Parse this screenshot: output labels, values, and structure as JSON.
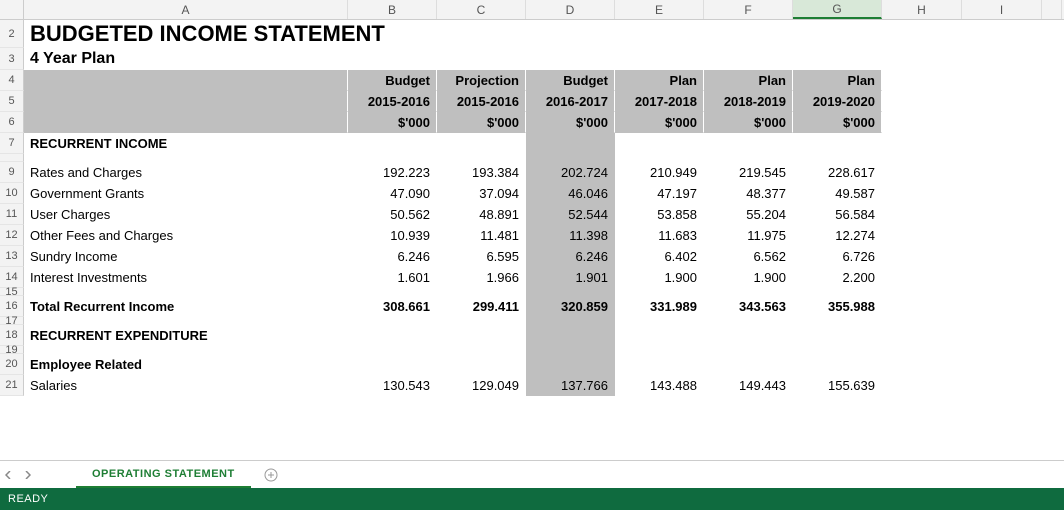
{
  "columns": [
    "A",
    "B",
    "C",
    "D",
    "E",
    "F",
    "G",
    "H",
    "I",
    ""
  ],
  "visible_row_numbers": [
    "2",
    "3",
    "4",
    "5",
    "6",
    "7",
    "",
    "9",
    "10",
    "11",
    "12",
    "13",
    "14",
    "15",
    "16",
    "17",
    "18",
    "19",
    "20",
    "21",
    ""
  ],
  "title": "BUDGETED INCOME STATEMENT",
  "subtitle": "4 Year Plan",
  "header_row1": [
    "Budget",
    "Projection",
    "Budget",
    "Plan",
    "Plan",
    "Plan"
  ],
  "header_row2": [
    "2015-2016",
    "2015-2016",
    "2016-2017",
    "2017-2018",
    "2018-2019",
    "2019-2020"
  ],
  "header_row3": [
    "$'000",
    "$'000",
    "$'000",
    "$'000",
    "$'000",
    "$'000"
  ],
  "section1": "RECURRENT INCOME",
  "rows_income": [
    {
      "label": "Rates and Charges",
      "v": [
        "192.223",
        "193.384",
        "202.724",
        "210.949",
        "219.545",
        "228.617"
      ]
    },
    {
      "label": "Government Grants",
      "v": [
        "47.090",
        "37.094",
        "46.046",
        "47.197",
        "48.377",
        "49.587"
      ]
    },
    {
      "label": "User Charges",
      "v": [
        "50.562",
        "48.891",
        "52.544",
        "53.858",
        "55.204",
        "56.584"
      ]
    },
    {
      "label": "Other Fees and Charges",
      "v": [
        "10.939",
        "11.481",
        "11.398",
        "11.683",
        "11.975",
        "12.274"
      ]
    },
    {
      "label": "Sundry Income",
      "v": [
        "6.246",
        "6.595",
        "6.246",
        "6.402",
        "6.562",
        "6.726"
      ]
    },
    {
      "label": "Interest Investments",
      "v": [
        "1.601",
        "1.966",
        "1.901",
        "1.900",
        "1.900",
        "2.200"
      ]
    }
  ],
  "total_income": {
    "label": "Total Recurrent Income",
    "v": [
      "308.661",
      "299.411",
      "320.859",
      "331.989",
      "343.563",
      "355.988"
    ]
  },
  "section2": "RECURRENT EXPENDITURE",
  "section3": "Employee Related",
  "rows_exp": [
    {
      "label": "Salaries",
      "v": [
        "130.543",
        "129.049",
        "137.766",
        "143.488",
        "149.443",
        "155.639"
      ]
    }
  ],
  "sheet_tab": "OPERATING STATEMENT",
  "status": "READY",
  "selected_column": "G",
  "chart_data": {
    "type": "table",
    "title": "BUDGETED INCOME STATEMENT — 4 Year Plan",
    "column_headers": [
      {
        "label": "Budget",
        "period": "2015-2016",
        "unit": "$'000"
      },
      {
        "label": "Projection",
        "period": "2015-2016",
        "unit": "$'000"
      },
      {
        "label": "Budget",
        "period": "2016-2017",
        "unit": "$'000"
      },
      {
        "label": "Plan",
        "period": "2017-2018",
        "unit": "$'000"
      },
      {
        "label": "Plan",
        "period": "2018-2019",
        "unit": "$'000"
      },
      {
        "label": "Plan",
        "period": "2019-2020",
        "unit": "$'000"
      }
    ],
    "sections": [
      {
        "name": "RECURRENT INCOME",
        "rows": [
          {
            "label": "Rates and Charges",
            "values": [
              192.223,
              193.384,
              202.724,
              210.949,
              219.545,
              228.617
            ]
          },
          {
            "label": "Government Grants",
            "values": [
              47.09,
              37.094,
              46.046,
              47.197,
              48.377,
              49.587
            ]
          },
          {
            "label": "User Charges",
            "values": [
              50.562,
              48.891,
              52.544,
              53.858,
              55.204,
              56.584
            ]
          },
          {
            "label": "Other Fees and Charges",
            "values": [
              10.939,
              11.481,
              11.398,
              11.683,
              11.975,
              12.274
            ]
          },
          {
            "label": "Sundry Income",
            "values": [
              6.246,
              6.595,
              6.246,
              6.402,
              6.562,
              6.726
            ]
          },
          {
            "label": "Interest Investments",
            "values": [
              1.601,
              1.966,
              1.901,
              1.9,
              1.9,
              2.2
            ]
          }
        ],
        "total": {
          "label": "Total Recurrent Income",
          "values": [
            308.661,
            299.411,
            320.859,
            331.989,
            343.563,
            355.988
          ]
        }
      },
      {
        "name": "RECURRENT EXPENDITURE",
        "subsections": [
          {
            "name": "Employee Related",
            "rows": [
              {
                "label": "Salaries",
                "values": [
                  130.543,
                  129.049,
                  137.766,
                  143.488,
                  149.443,
                  155.639
                ]
              }
            ]
          }
        ]
      }
    ]
  }
}
